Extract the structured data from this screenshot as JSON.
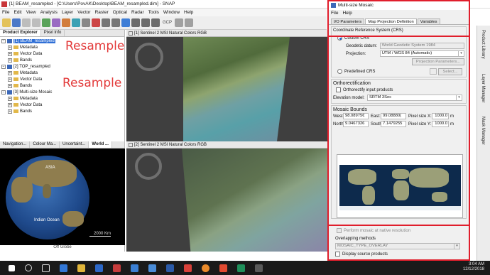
{
  "window": {
    "title": "[1] BEAM_resampled - [C:\\Users\\PovAK\\Desktop\\BEAM_resampled.dim] - SNAP"
  },
  "menubar": [
    "File",
    "Edit",
    "View",
    "Analysis",
    "Layer",
    "Vector",
    "Raster",
    "Optical",
    "Radar",
    "Tools",
    "Window",
    "Help"
  ],
  "toolbar": {
    "gcp_label": "GCP"
  },
  "product_explorer": {
    "tabs": [
      "Product Explorer",
      "Pixel Info"
    ],
    "tree": [
      {
        "label": "[1] BEAM_resampled",
        "level": 0,
        "selected": true
      },
      {
        "label": "Metadata",
        "level": 1
      },
      {
        "label": "Vector Data",
        "level": 1
      },
      {
        "label": "Bands",
        "level": 1
      },
      {
        "label": "[2] TOP_resampled",
        "level": 0
      },
      {
        "label": "Metadata",
        "level": 1
      },
      {
        "label": "Vector Data",
        "level": 1
      },
      {
        "label": "Bands",
        "level": 1
      },
      {
        "label": "[3] Multi-size Mosaic",
        "level": 0
      },
      {
        "label": "Metadata",
        "level": 1
      },
      {
        "label": "Vector Data",
        "level": 1
      },
      {
        "label": "Bands",
        "level": 1
      }
    ],
    "annotations": [
      "Resample 1",
      "Resample 2"
    ]
  },
  "navigation_panel": {
    "tabs": [
      "Navigation...",
      "Colour Ma...",
      "Uncertaint...",
      "World ..."
    ],
    "labels": {
      "asia": "ASIA",
      "ocean": "Indian Ocean"
    },
    "scale": "2000 Km",
    "footer": "Off Globe"
  },
  "image_views": [
    {
      "tab": "[1] Sentinel 2 MSI Natural Colors RGB"
    },
    {
      "tab": "[2] Sentinel 2 MSI Natural Colors RGB"
    }
  ],
  "mosaic_dialog": {
    "title": "Multi-size Mosaic",
    "menu": [
      "File",
      "Help"
    ],
    "tabs": [
      "I/O Parameters",
      "Map Projection Definition",
      "Variables"
    ],
    "crs_title": "Coordinate Reference System (CRS)",
    "custom_crs": "Custom CRS",
    "geodetic_label": "Geodetic datum:",
    "geodetic_value": "World Geodetic System 1984",
    "projection_label": "Projection:",
    "projection_value": "UTM / WGS 84 (Automatic)",
    "projection_params_button": "Projection Parameters...",
    "predefined_crs": "Predefined CRS",
    "select_button": "Select...",
    "ortho_title": "Orthorectification",
    "ortho_checkbox": "Orthorectify input products",
    "elevation_label": "Elevation model:",
    "elevation_value": "SRTM 3Sec",
    "bounds_title": "Mosaic Bounds",
    "west_label": "West:",
    "west_value": "98.08975€",
    "east_label": "East:",
    "east_value": "99.08880(",
    "north_label": "North:",
    "north_value": "9.0467326",
    "south_label": "South:",
    "south_value": "7.1479255",
    "pixel_x_label": "Pixel size X:",
    "pixel_x_value": "1000.0",
    "pixel_y_label": "Pixel size Y:",
    "pixel_y_value": "1000.0",
    "unit": "m",
    "native_resolution": "Perform mosaic at native resolution",
    "overlap_label": "Overlapping methods",
    "overlap_value": "MOSAIC_TYPE_OVERLAY",
    "display_source": "Display source products"
  },
  "side_panels": [
    "Product Library",
    "Layer Manager",
    "Mask Manager"
  ],
  "taskbar": {
    "time": "3:04 AM",
    "date": "12/12/2018"
  },
  "colors": {
    "highlight": "#e01e2c",
    "selection": "#2f6fd6",
    "annotation": "#e33b3b"
  }
}
